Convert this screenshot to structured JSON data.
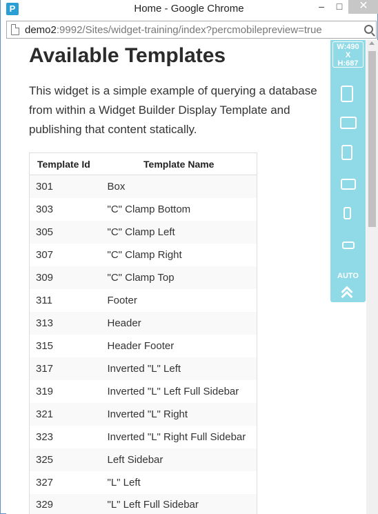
{
  "window": {
    "title": "Home - Google Chrome",
    "app_icon": "P",
    "minimize": "–",
    "maximize": "□",
    "close": "✕"
  },
  "address_bar": {
    "host": "demo2",
    "path": ":9992/Sites/widget-training/index?percmobilepreview=true"
  },
  "page": {
    "heading": "Available Templates",
    "intro": "This widget is a simple example of querying a database from within a Widget Builder Display Template and publishing that content statically.",
    "table": {
      "headers": [
        "Template Id",
        "Template Name"
      ],
      "rows": [
        [
          "301",
          "Box"
        ],
        [
          "303",
          "\"C\" Clamp Bottom"
        ],
        [
          "305",
          "\"C\" Clamp Left"
        ],
        [
          "307",
          "\"C\" Clamp Right"
        ],
        [
          "309",
          "\"C\" Clamp Top"
        ],
        [
          "311",
          "Footer"
        ],
        [
          "313",
          "Header"
        ],
        [
          "315",
          "Header Footer"
        ],
        [
          "317",
          "Inverted \"L\" Left"
        ],
        [
          "319",
          "Inverted \"L\" Left Full Sidebar"
        ],
        [
          "321",
          "Inverted \"L\" Right"
        ],
        [
          "323",
          "Inverted \"L\" Right Full Sidebar"
        ],
        [
          "325",
          "Left Sidebar"
        ],
        [
          "327",
          "\"L\" Left"
        ],
        [
          "329",
          "\"L\" Left Full Sidebar"
        ]
      ]
    }
  },
  "device_panel": {
    "width_label": "W:490",
    "x_label": "X",
    "height_label": "H:687",
    "auto_label": "AUTO",
    "accent_color": "#8fdae6"
  }
}
